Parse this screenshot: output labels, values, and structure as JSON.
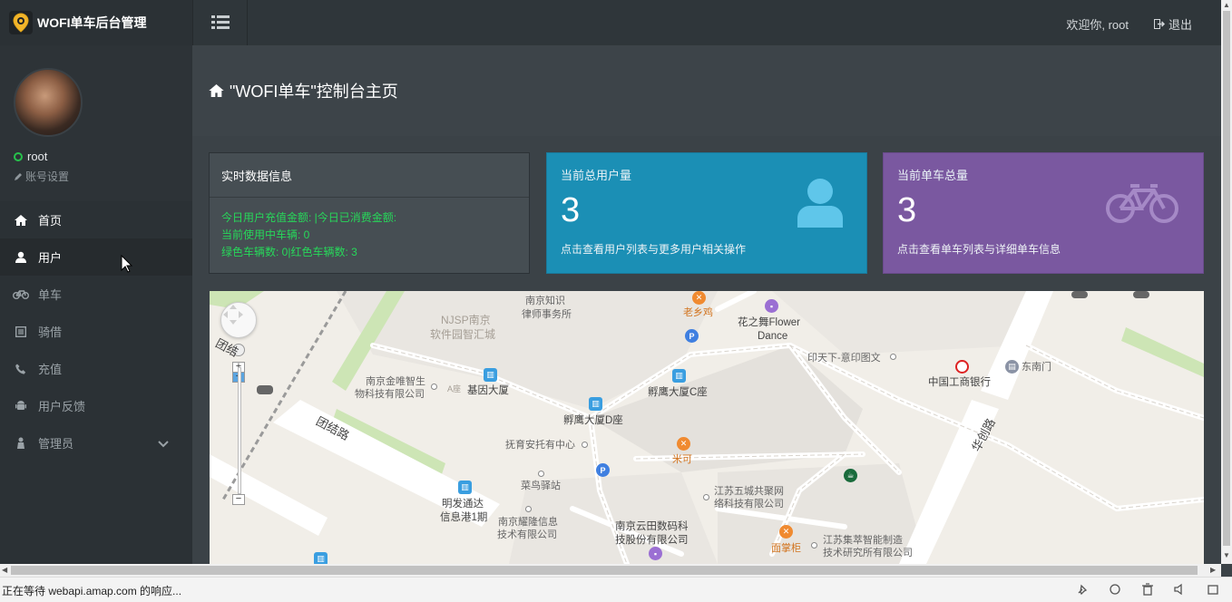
{
  "brand": {
    "title": "WOFI单车后台管理"
  },
  "topbar": {
    "welcome": "欢迎你, root",
    "logout": "退出"
  },
  "profile": {
    "username": "root",
    "account_settings": "账号设置"
  },
  "sidebar": {
    "items": [
      {
        "label": "首页",
        "icon": "home-icon"
      },
      {
        "label": "用户",
        "icon": "user-icon"
      },
      {
        "label": "单车",
        "icon": "bicycle-icon"
      },
      {
        "label": "骑借",
        "icon": "list-icon"
      },
      {
        "label": "充值",
        "icon": "phone-icon"
      },
      {
        "label": "用户反馈",
        "icon": "android-icon"
      },
      {
        "label": "管理员",
        "icon": "admin-icon"
      }
    ]
  },
  "page": {
    "title": "\"WOFI单车\"控制台主页"
  },
  "realtime": {
    "title": "实时数据信息",
    "line1": "今日用户充值金额: |今日已消费金额:",
    "line2": "当前使用中车辆: 0",
    "line3": "绿色车辆数: 0|红色车辆数: 3"
  },
  "cards": {
    "users": {
      "title": "当前总用户量",
      "value": "3",
      "desc": "点击查看用户列表与更多用户相关操作",
      "color": "#1b8fb5"
    },
    "bikes": {
      "title": "当前单车总量",
      "value": "3",
      "desc": "点击查看单车列表与详细单车信息",
      "color": "#7a58a0"
    }
  },
  "map": {
    "labels": {
      "l1": "南京知识",
      "l2": "律师事务所",
      "l3": "老乡鸡",
      "l4": "花之舞Flower",
      "l5": "Dance",
      "l6": "NJSP南京",
      "l7": "软件园智汇城",
      "l8": "印天下-意印图文",
      "l9": "中国工商银行",
      "l10": "东南门",
      "l11": "南京金唯智生",
      "l12": "物科技有限公司",
      "l13": "A座",
      "l14": "基因大厦",
      "l15": "孵鹰大厦C座",
      "l16": "孵鹰大厦D座",
      "l17": "抚育安托有中心",
      "l18": "米可",
      "l19": "团结路",
      "l20": "菜鸟驿站",
      "l21": "江苏五城共聚网",
      "l22": "络科技有限公司",
      "l23": "明发通达",
      "l24": "信息港1期",
      "l25": "南京耀隆信息",
      "l26": "技术有限公司",
      "l27": "南京云田数码科",
      "l28": "技股份有限公司",
      "l29": "面掌柜",
      "l30": "江苏集萃智能制造",
      "l31": "技术研究所有限公司",
      "l32": "团结",
      "l33": "华创路"
    }
  },
  "status": {
    "text": "正在等待 webapi.amap.com 的响应..."
  }
}
